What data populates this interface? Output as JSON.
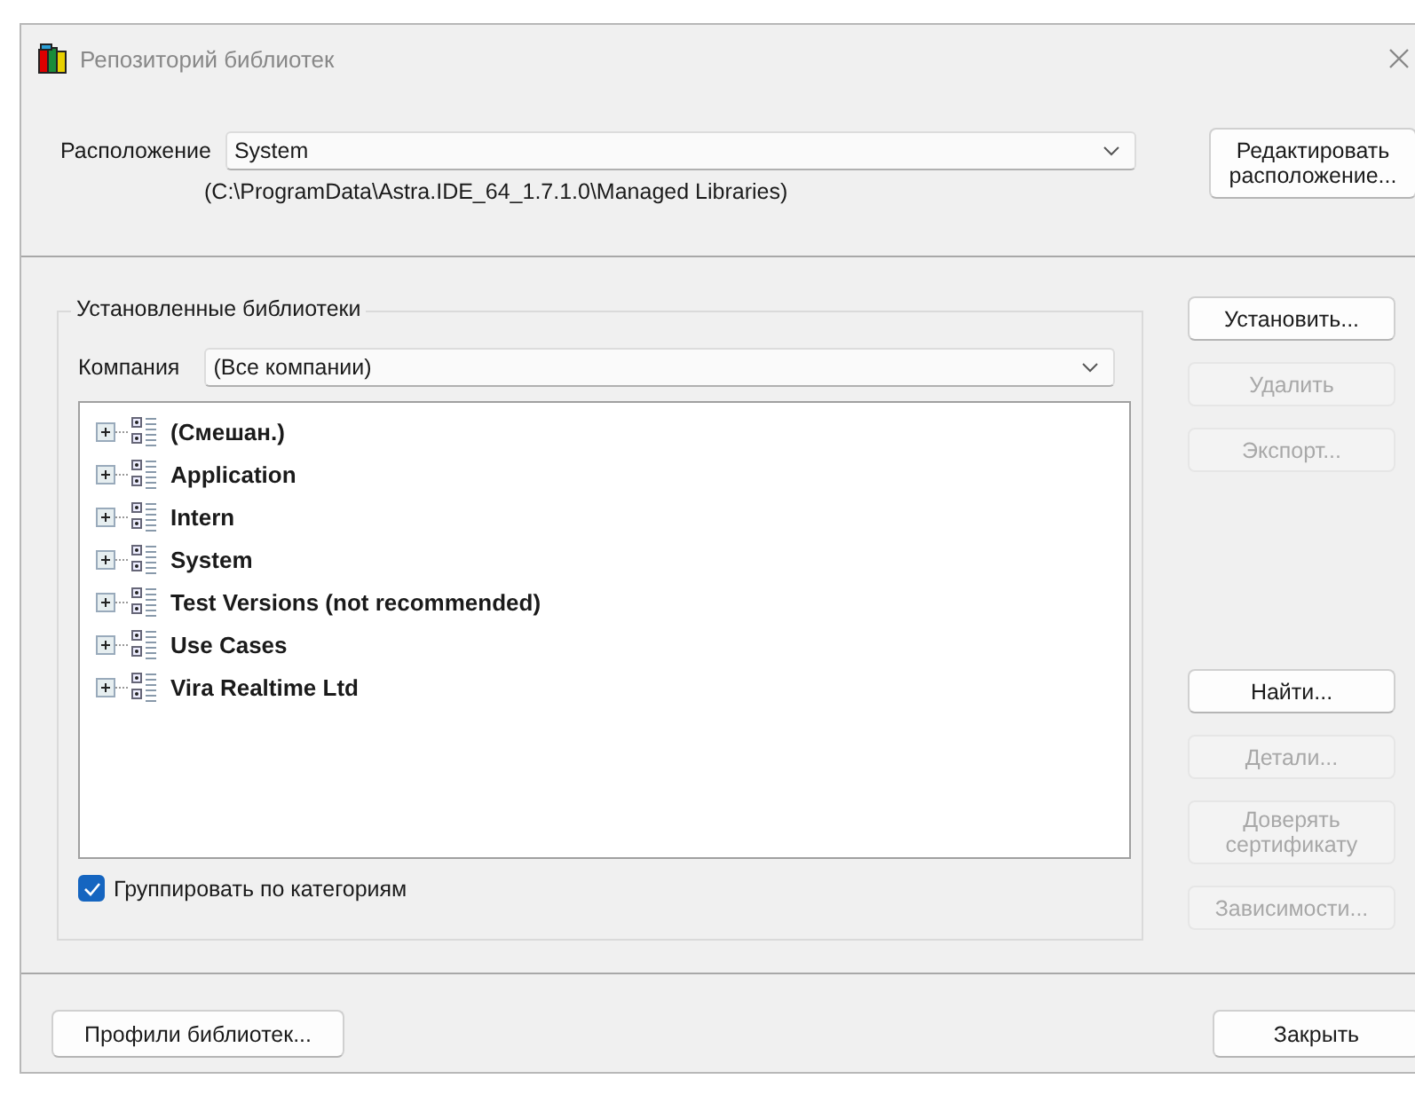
{
  "window": {
    "title": "Репозиторий библиотек"
  },
  "location": {
    "label": "Расположение",
    "value": "System",
    "path": "(C:\\ProgramData\\Astra.IDE_64_1.7.1.0\\Managed Libraries)",
    "edit_button": "Редактировать расположение..."
  },
  "installed": {
    "title": "Установленные библиотеки",
    "company_label": "Компания",
    "company_value": "(Все компании)",
    "tree": [
      {
        "label": "(Смешан.)",
        "expanded": false
      },
      {
        "label": "Application",
        "expanded": false
      },
      {
        "label": "Intern",
        "expanded": false
      },
      {
        "label": "System",
        "expanded": false
      },
      {
        "label": "Test Versions (not recommended)",
        "expanded": false
      },
      {
        "label": "Use Cases",
        "expanded": false
      },
      {
        "label": "Vira Realtime Ltd",
        "expanded": false
      }
    ],
    "group_checkbox": {
      "label": "Группировать по категориям",
      "checked": true
    }
  },
  "side_buttons": {
    "top": [
      {
        "label": "Установить...",
        "disabled": false
      },
      {
        "label": "Удалить",
        "disabled": true
      },
      {
        "label": "Экспорт...",
        "disabled": true
      }
    ],
    "bottom": [
      {
        "label": "Найти...",
        "disabled": false
      },
      {
        "label": "Детали...",
        "disabled": true
      },
      {
        "label": "Доверять сертификату",
        "disabled": true
      },
      {
        "label": "Зависимости...",
        "disabled": true
      }
    ]
  },
  "footer": {
    "left_button": "Профили библиотек...",
    "close_button": "Закрыть"
  }
}
